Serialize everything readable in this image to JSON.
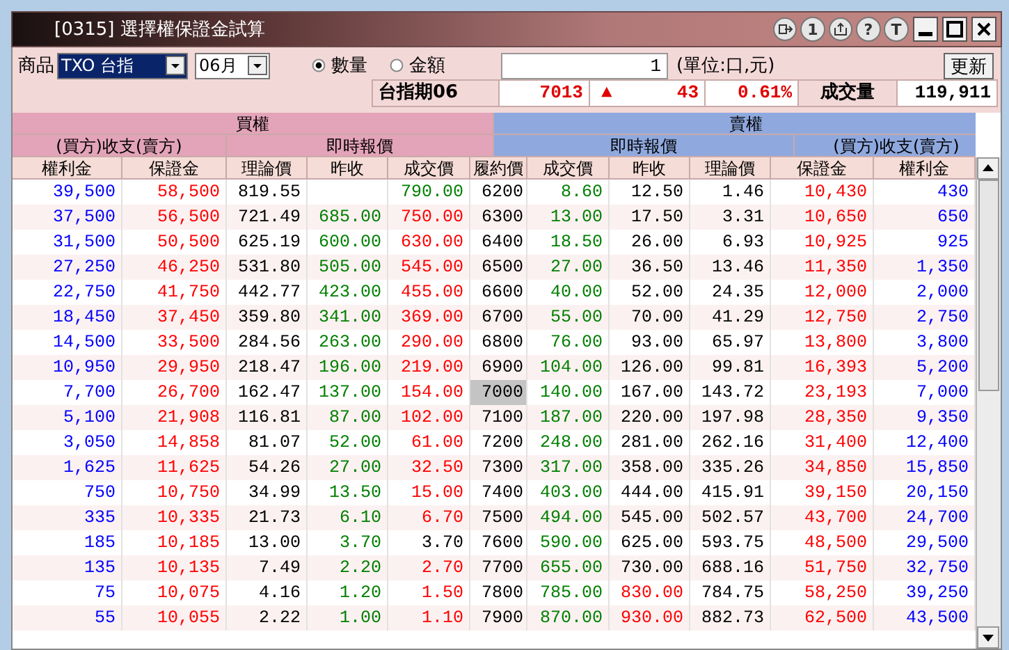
{
  "window": {
    "title": "[0315] 選擇權保證金試算",
    "title_buttons": [
      "1",
      "?",
      "T"
    ]
  },
  "toolbar": {
    "product_label": "商品",
    "product": "TXO 台指",
    "month": "06月",
    "modes": [
      {
        "label": "數量",
        "selected": true
      },
      {
        "label": "金額",
        "selected": false
      }
    ],
    "quantity": "1",
    "unit": "(單位:口,元)",
    "refresh": "更新"
  },
  "quote": {
    "name": "台指期06",
    "price": "7013",
    "arrow": "▲",
    "change": "43",
    "percent": "0.61%",
    "volume_label": "成交量",
    "volume": "119,911"
  },
  "table": {
    "groups": [
      "買權",
      "賣權"
    ],
    "subgroups": [
      "(買方)收支(賣方)",
      "即時報價",
      "即時報價",
      "(買方)收支(賣方)"
    ],
    "columns": [
      "權利金",
      "保證金",
      "理論價",
      "昨收",
      "成交價",
      "履約價",
      "成交價",
      "昨收",
      "理論價",
      "保證金",
      "權利金"
    ],
    "rows": [
      {
        "highlighted": false,
        "cells": [
          {
            "text": "39,500",
            "color": "#0000ff"
          },
          {
            "text": "58,500",
            "color": "#ff0000"
          },
          {
            "text": "819.55",
            "color": "#000000"
          },
          {},
          {
            "text": "790.00",
            "color": "#008000"
          },
          {
            "text": "6200",
            "color": "#000000"
          },
          {
            "text": "8.60",
            "color": "#008000"
          },
          {
            "text": "12.50",
            "color": "#000000"
          },
          {
            "text": "1.46",
            "color": "#000000"
          },
          {
            "text": "10,430",
            "color": "#ff0000"
          },
          {
            "text": "430",
            "color": "#0000ff"
          }
        ]
      },
      {
        "highlighted": false,
        "cells": [
          {
            "text": "37,500",
            "color": "#0000ff"
          },
          {
            "text": "56,500",
            "color": "#ff0000"
          },
          {
            "text": "721.49",
            "color": "#000000"
          },
          {
            "text": "685.00",
            "color": "#008000"
          },
          {
            "text": "750.00",
            "color": "#ff0000"
          },
          {
            "text": "6300",
            "color": "#000000"
          },
          {
            "text": "13.00",
            "color": "#008000"
          },
          {
            "text": "17.50",
            "color": "#000000"
          },
          {
            "text": "3.31",
            "color": "#000000"
          },
          {
            "text": "10,650",
            "color": "#ff0000"
          },
          {
            "text": "650",
            "color": "#0000ff"
          }
        ]
      },
      {
        "highlighted": false,
        "cells": [
          {
            "text": "31,500",
            "color": "#0000ff"
          },
          {
            "text": "50,500",
            "color": "#ff0000"
          },
          {
            "text": "625.19",
            "color": "#000000"
          },
          {
            "text": "600.00",
            "color": "#008000"
          },
          {
            "text": "630.00",
            "color": "#ff0000"
          },
          {
            "text": "6400",
            "color": "#000000"
          },
          {
            "text": "18.50",
            "color": "#008000"
          },
          {
            "text": "26.00",
            "color": "#000000"
          },
          {
            "text": "6.93",
            "color": "#000000"
          },
          {
            "text": "10,925",
            "color": "#ff0000"
          },
          {
            "text": "925",
            "color": "#0000ff"
          }
        ]
      },
      {
        "highlighted": false,
        "cells": [
          {
            "text": "27,250",
            "color": "#0000ff"
          },
          {
            "text": "46,250",
            "color": "#ff0000"
          },
          {
            "text": "531.80",
            "color": "#000000"
          },
          {
            "text": "505.00",
            "color": "#008000"
          },
          {
            "text": "545.00",
            "color": "#ff0000"
          },
          {
            "text": "6500",
            "color": "#000000"
          },
          {
            "text": "27.00",
            "color": "#008000"
          },
          {
            "text": "36.50",
            "color": "#000000"
          },
          {
            "text": "13.46",
            "color": "#000000"
          },
          {
            "text": "11,350",
            "color": "#ff0000"
          },
          {
            "text": "1,350",
            "color": "#0000ff"
          }
        ]
      },
      {
        "highlighted": false,
        "cells": [
          {
            "text": "22,750",
            "color": "#0000ff"
          },
          {
            "text": "41,750",
            "color": "#ff0000"
          },
          {
            "text": "442.77",
            "color": "#000000"
          },
          {
            "text": "423.00",
            "color": "#008000"
          },
          {
            "text": "455.00",
            "color": "#ff0000"
          },
          {
            "text": "6600",
            "color": "#000000"
          },
          {
            "text": "40.00",
            "color": "#008000"
          },
          {
            "text": "52.00",
            "color": "#000000"
          },
          {
            "text": "24.35",
            "color": "#000000"
          },
          {
            "text": "12,000",
            "color": "#ff0000"
          },
          {
            "text": "2,000",
            "color": "#0000ff"
          }
        ]
      },
      {
        "highlighted": false,
        "cells": [
          {
            "text": "18,450",
            "color": "#0000ff"
          },
          {
            "text": "37,450",
            "color": "#ff0000"
          },
          {
            "text": "359.80",
            "color": "#000000"
          },
          {
            "text": "341.00",
            "color": "#008000"
          },
          {
            "text": "369.00",
            "color": "#ff0000"
          },
          {
            "text": "6700",
            "color": "#000000"
          },
          {
            "text": "55.00",
            "color": "#008000"
          },
          {
            "text": "70.00",
            "color": "#000000"
          },
          {
            "text": "41.29",
            "color": "#000000"
          },
          {
            "text": "12,750",
            "color": "#ff0000"
          },
          {
            "text": "2,750",
            "color": "#0000ff"
          }
        ]
      },
      {
        "highlighted": false,
        "cells": [
          {
            "text": "14,500",
            "color": "#0000ff"
          },
          {
            "text": "33,500",
            "color": "#ff0000"
          },
          {
            "text": "284.56",
            "color": "#000000"
          },
          {
            "text": "263.00",
            "color": "#008000"
          },
          {
            "text": "290.00",
            "color": "#ff0000"
          },
          {
            "text": "6800",
            "color": "#000000"
          },
          {
            "text": "76.00",
            "color": "#008000"
          },
          {
            "text": "93.00",
            "color": "#000000"
          },
          {
            "text": "65.97",
            "color": "#000000"
          },
          {
            "text": "13,800",
            "color": "#ff0000"
          },
          {
            "text": "3,800",
            "color": "#0000ff"
          }
        ]
      },
      {
        "highlighted": false,
        "cells": [
          {
            "text": "10,950",
            "color": "#0000ff"
          },
          {
            "text": "29,950",
            "color": "#ff0000"
          },
          {
            "text": "218.47",
            "color": "#000000"
          },
          {
            "text": "196.00",
            "color": "#008000"
          },
          {
            "text": "219.00",
            "color": "#ff0000"
          },
          {
            "text": "6900",
            "color": "#000000"
          },
          {
            "text": "104.00",
            "color": "#008000"
          },
          {
            "text": "126.00",
            "color": "#000000"
          },
          {
            "text": "99.81",
            "color": "#000000"
          },
          {
            "text": "16,393",
            "color": "#ff0000"
          },
          {
            "text": "5,200",
            "color": "#0000ff"
          }
        ]
      },
      {
        "highlighted": true,
        "cells": [
          {
            "text": "7,700",
            "color": "#0000ff"
          },
          {
            "text": "26,700",
            "color": "#ff0000"
          },
          {
            "text": "162.47",
            "color": "#000000"
          },
          {
            "text": "137.00",
            "color": "#008000"
          },
          {
            "text": "154.00",
            "color": "#ff0000"
          },
          {
            "text": "7000",
            "color": "#000000"
          },
          {
            "text": "140.00",
            "color": "#008000"
          },
          {
            "text": "167.00",
            "color": "#000000"
          },
          {
            "text": "143.72",
            "color": "#000000"
          },
          {
            "text": "23,193",
            "color": "#ff0000"
          },
          {
            "text": "7,000",
            "color": "#0000ff"
          }
        ]
      },
      {
        "highlighted": false,
        "cells": [
          {
            "text": "5,100",
            "color": "#0000ff"
          },
          {
            "text": "21,908",
            "color": "#ff0000"
          },
          {
            "text": "116.81",
            "color": "#000000"
          },
          {
            "text": "87.00",
            "color": "#008000"
          },
          {
            "text": "102.00",
            "color": "#ff0000"
          },
          {
            "text": "7100",
            "color": "#000000"
          },
          {
            "text": "187.00",
            "color": "#008000"
          },
          {
            "text": "220.00",
            "color": "#000000"
          },
          {
            "text": "197.98",
            "color": "#000000"
          },
          {
            "text": "28,350",
            "color": "#ff0000"
          },
          {
            "text": "9,350",
            "color": "#0000ff"
          }
        ]
      },
      {
        "highlighted": false,
        "cells": [
          {
            "text": "3,050",
            "color": "#0000ff"
          },
          {
            "text": "14,858",
            "color": "#ff0000"
          },
          {
            "text": "81.07",
            "color": "#000000"
          },
          {
            "text": "52.00",
            "color": "#008000"
          },
          {
            "text": "61.00",
            "color": "#ff0000"
          },
          {
            "text": "7200",
            "color": "#000000"
          },
          {
            "text": "248.00",
            "color": "#008000"
          },
          {
            "text": "281.00",
            "color": "#000000"
          },
          {
            "text": "262.16",
            "color": "#000000"
          },
          {
            "text": "31,400",
            "color": "#ff0000"
          },
          {
            "text": "12,400",
            "color": "#0000ff"
          }
        ]
      },
      {
        "highlighted": false,
        "cells": [
          {
            "text": "1,625",
            "color": "#0000ff"
          },
          {
            "text": "11,625",
            "color": "#ff0000"
          },
          {
            "text": "54.26",
            "color": "#000000"
          },
          {
            "text": "27.00",
            "color": "#008000"
          },
          {
            "text": "32.50",
            "color": "#ff0000"
          },
          {
            "text": "7300",
            "color": "#000000"
          },
          {
            "text": "317.00",
            "color": "#008000"
          },
          {
            "text": "358.00",
            "color": "#000000"
          },
          {
            "text": "335.26",
            "color": "#000000"
          },
          {
            "text": "34,850",
            "color": "#ff0000"
          },
          {
            "text": "15,850",
            "color": "#0000ff"
          }
        ]
      },
      {
        "highlighted": false,
        "cells": [
          {
            "text": "750",
            "color": "#0000ff"
          },
          {
            "text": "10,750",
            "color": "#ff0000"
          },
          {
            "text": "34.99",
            "color": "#000000"
          },
          {
            "text": "13.50",
            "color": "#008000"
          },
          {
            "text": "15.00",
            "color": "#ff0000"
          },
          {
            "text": "7400",
            "color": "#000000"
          },
          {
            "text": "403.00",
            "color": "#008000"
          },
          {
            "text": "444.00",
            "color": "#000000"
          },
          {
            "text": "415.91",
            "color": "#000000"
          },
          {
            "text": "39,150",
            "color": "#ff0000"
          },
          {
            "text": "20,150",
            "color": "#0000ff"
          }
        ]
      },
      {
        "highlighted": false,
        "cells": [
          {
            "text": "335",
            "color": "#0000ff"
          },
          {
            "text": "10,335",
            "color": "#ff0000"
          },
          {
            "text": "21.73",
            "color": "#000000"
          },
          {
            "text": "6.10",
            "color": "#008000"
          },
          {
            "text": "6.70",
            "color": "#ff0000"
          },
          {
            "text": "7500",
            "color": "#000000"
          },
          {
            "text": "494.00",
            "color": "#008000"
          },
          {
            "text": "545.00",
            "color": "#000000"
          },
          {
            "text": "502.57",
            "color": "#000000"
          },
          {
            "text": "43,700",
            "color": "#ff0000"
          },
          {
            "text": "24,700",
            "color": "#0000ff"
          }
        ]
      },
      {
        "highlighted": false,
        "cells": [
          {
            "text": "185",
            "color": "#0000ff"
          },
          {
            "text": "10,185",
            "color": "#ff0000"
          },
          {
            "text": "13.00",
            "color": "#000000"
          },
          {
            "text": "3.70",
            "color": "#008000"
          },
          {
            "text": "3.70",
            "color": "#000000"
          },
          {
            "text": "7600",
            "color": "#000000"
          },
          {
            "text": "590.00",
            "color": "#008000"
          },
          {
            "text": "625.00",
            "color": "#000000"
          },
          {
            "text": "593.75",
            "color": "#000000"
          },
          {
            "text": "48,500",
            "color": "#ff0000"
          },
          {
            "text": "29,500",
            "color": "#0000ff"
          }
        ]
      },
      {
        "highlighted": false,
        "cells": [
          {
            "text": "135",
            "color": "#0000ff"
          },
          {
            "text": "10,135",
            "color": "#ff0000"
          },
          {
            "text": "7.49",
            "color": "#000000"
          },
          {
            "text": "2.20",
            "color": "#008000"
          },
          {
            "text": "2.70",
            "color": "#ff0000"
          },
          {
            "text": "7700",
            "color": "#000000"
          },
          {
            "text": "655.00",
            "color": "#008000"
          },
          {
            "text": "730.00",
            "color": "#000000"
          },
          {
            "text": "688.16",
            "color": "#000000"
          },
          {
            "text": "51,750",
            "color": "#ff0000"
          },
          {
            "text": "32,750",
            "color": "#0000ff"
          }
        ]
      },
      {
        "highlighted": false,
        "cells": [
          {
            "text": "75",
            "color": "#0000ff"
          },
          {
            "text": "10,075",
            "color": "#ff0000"
          },
          {
            "text": "4.16",
            "color": "#000000"
          },
          {
            "text": "1.20",
            "color": "#008000"
          },
          {
            "text": "1.50",
            "color": "#ff0000"
          },
          {
            "text": "7800",
            "color": "#000000"
          },
          {
            "text": "785.00",
            "color": "#008000"
          },
          {
            "text": "830.00",
            "color": "#ff0000"
          },
          {
            "text": "784.75",
            "color": "#000000"
          },
          {
            "text": "58,250",
            "color": "#ff0000"
          },
          {
            "text": "39,250",
            "color": "#0000ff"
          }
        ]
      },
      {
        "highlighted": false,
        "cells": [
          {
            "text": "55",
            "color": "#0000ff"
          },
          {
            "text": "10,055",
            "color": "#ff0000"
          },
          {
            "text": "2.22",
            "color": "#000000"
          },
          {
            "text": "1.00",
            "color": "#008000"
          },
          {
            "text": "1.10",
            "color": "#ff0000"
          },
          {
            "text": "7900",
            "color": "#000000"
          },
          {
            "text": "870.00",
            "color": "#008000"
          },
          {
            "text": "930.00",
            "color": "#ff0000"
          },
          {
            "text": "882.73",
            "color": "#000000"
          },
          {
            "text": "62,500",
            "color": "#ff0000"
          },
          {
            "text": "43,500",
            "color": "#0000ff"
          }
        ]
      }
    ]
  }
}
